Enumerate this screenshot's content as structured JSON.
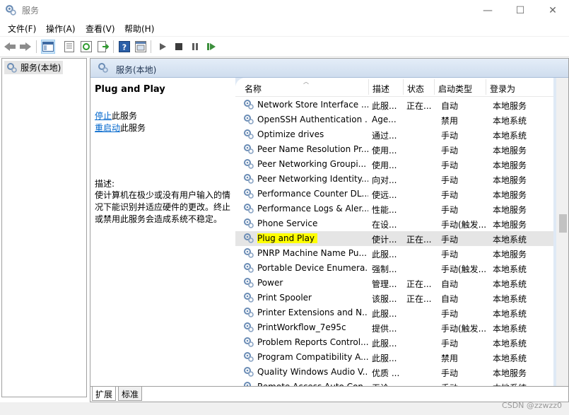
{
  "window": {
    "title": "服务",
    "minimize": "—",
    "maximize": "☐",
    "close": "✕"
  },
  "menu": [
    "文件(F)",
    "操作(A)",
    "查看(V)",
    "帮助(H)"
  ],
  "toolbar": {
    "icons": [
      "back-icon",
      "forward-icon",
      "show-hide-tree-icon",
      "properties-icon",
      "refresh-icon",
      "export-list-icon",
      "help-icon",
      "console-view-icon",
      "start-service-icon",
      "stop-service-icon",
      "pause-service-icon",
      "restart-service-icon"
    ]
  },
  "tree": {
    "item_label": "服务(本地)"
  },
  "right_header": {
    "label": "服务(本地)"
  },
  "description": {
    "service_name": "Plug and Play",
    "stop_link": "停止",
    "stop_suffix": "此服务",
    "restart_link": "重启动",
    "restart_suffix": "此服务",
    "desc_label": "描述:",
    "desc_text": "使计算机在极少或没有用户输入的情况下能识别并适应硬件的更改。终止或禁用此服务会造成系统不稳定。"
  },
  "columns": [
    "名称",
    "描述",
    "状态",
    "启动类型",
    "登录为"
  ],
  "rows": [
    {
      "name": "Network Store Interface ...",
      "desc": "此服...",
      "status": "正在...",
      "startup": "自动",
      "logon": "本地服务"
    },
    {
      "name": "OpenSSH Authentication ...",
      "desc": "Age...",
      "status": "",
      "startup": "禁用",
      "logon": "本地系统"
    },
    {
      "name": "Optimize drives",
      "desc": "通过...",
      "status": "",
      "startup": "手动",
      "logon": "本地系统"
    },
    {
      "name": "Peer Name Resolution Pr...",
      "desc": "使用...",
      "status": "",
      "startup": "手动",
      "logon": "本地服务"
    },
    {
      "name": "Peer Networking Groupi...",
      "desc": "使用...",
      "status": "",
      "startup": "手动",
      "logon": "本地服务"
    },
    {
      "name": "Peer Networking Identity...",
      "desc": "向对...",
      "status": "",
      "startup": "手动",
      "logon": "本地服务"
    },
    {
      "name": "Performance Counter DL...",
      "desc": "使远...",
      "status": "",
      "startup": "手动",
      "logon": "本地服务"
    },
    {
      "name": "Performance Logs & Aler...",
      "desc": "性能...",
      "status": "",
      "startup": "手动",
      "logon": "本地服务"
    },
    {
      "name": "Phone Service",
      "desc": "在设...",
      "status": "",
      "startup": "手动(触发...",
      "logon": "本地服务"
    },
    {
      "name": "Plug and Play",
      "desc": "使计...",
      "status": "正在...",
      "startup": "手动",
      "logon": "本地系统"
    },
    {
      "name": "PNRP Machine Name Pu...",
      "desc": "此服...",
      "status": "",
      "startup": "手动",
      "logon": "本地服务"
    },
    {
      "name": "Portable Device Enumera...",
      "desc": "强制...",
      "status": "",
      "startup": "手动(触发...",
      "logon": "本地系统"
    },
    {
      "name": "Power",
      "desc": "管理...",
      "status": "正在...",
      "startup": "自动",
      "logon": "本地系统"
    },
    {
      "name": "Print Spooler",
      "desc": "该服...",
      "status": "正在...",
      "startup": "自动",
      "logon": "本地系统"
    },
    {
      "name": "Printer Extensions and N...",
      "desc": "此服...",
      "status": "",
      "startup": "手动",
      "logon": "本地系统"
    },
    {
      "name": "PrintWorkflow_7e95c",
      "desc": "提供...",
      "status": "",
      "startup": "手动(触发...",
      "logon": "本地系统"
    },
    {
      "name": "Problem Reports Control...",
      "desc": "此服...",
      "status": "",
      "startup": "手动",
      "logon": "本地系统"
    },
    {
      "name": "Program Compatibility A...",
      "desc": "此服...",
      "status": "",
      "startup": "禁用",
      "logon": "本地系统"
    },
    {
      "name": "Quality Windows Audio V...",
      "desc": "优质 ...",
      "status": "",
      "startup": "手动",
      "logon": "本地服务"
    },
    {
      "name": "Remote Access Auto Con...",
      "desc": "无论...",
      "status": "",
      "startup": "手动",
      "logon": "本地系统"
    }
  ],
  "selected_row": 9,
  "highlight_color": "#ffff00",
  "tabs": [
    "扩展",
    "标准"
  ],
  "watermark": "CSDN @zzwzz0"
}
